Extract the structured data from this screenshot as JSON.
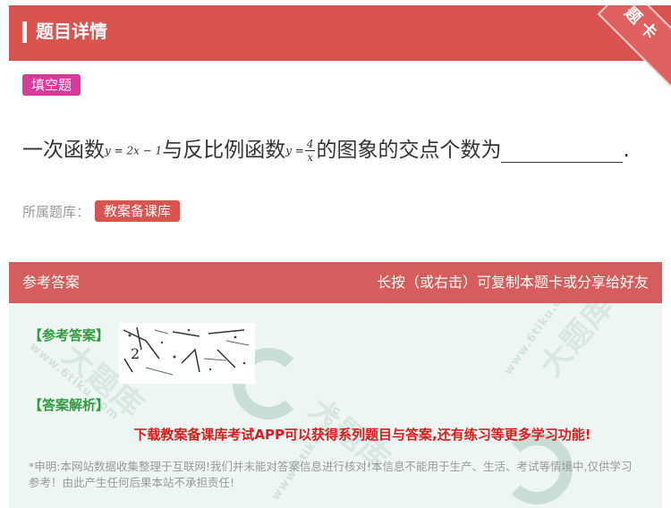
{
  "header": {
    "title": "题目详情",
    "corner_label": "题卡"
  },
  "question": {
    "type_tag": "填空题",
    "text_before": "一次函数",
    "linear_expr": "y = 2x − 1",
    "text_middle": "与反比例函数",
    "inverse_lhs": "y =",
    "inverse_num": "4",
    "inverse_den": "x",
    "text_after": "的图象的交点个数为",
    "end_mark": "."
  },
  "bank": {
    "label": "所属题库：",
    "tag": "教案备课库"
  },
  "answer_section": {
    "title": "参考答案",
    "hint": "长按（或右击）可复制本题卡或分享给好友",
    "answer_label": "【参考答案】",
    "answer_image_text": "2",
    "explain_label": "【答案解析】",
    "promo": "下载教案备课库考试APP可以获得系列题目与答案,还有练习等更多学习功能!",
    "disclaimer": "*申明:本网站数据收集整理于互联网!我们并未能对答案信息进行核对!本信息不能用于生产、生活、考试等情境中,仅供学习参考！由此产生任何后果本站不承担责任!"
  },
  "watermark": {
    "site": "www.6tiku.com",
    "brand": "大题库"
  },
  "colors": {
    "header_red": "#d9534f",
    "answer_header": "#d55d5d",
    "type_tag": "#d63a9a",
    "answer_green": "#2e9b3c",
    "promo_red": "#e01a1a",
    "answer_bg": "#eef6f3"
  }
}
